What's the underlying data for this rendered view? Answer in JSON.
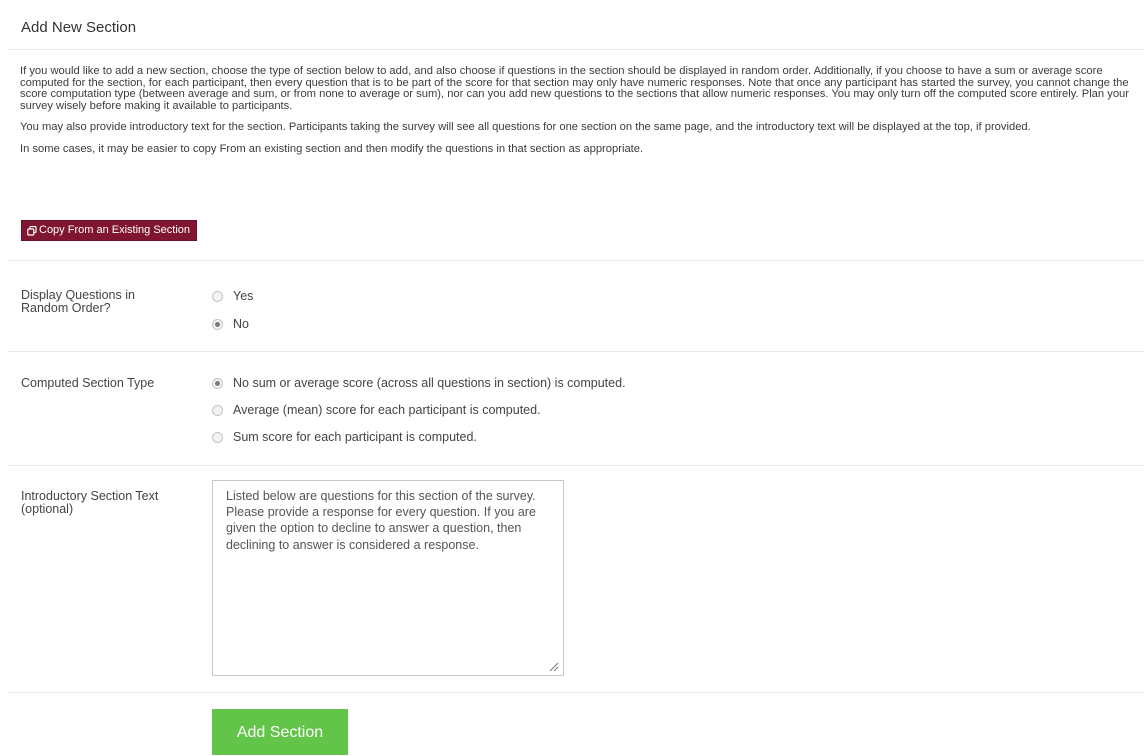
{
  "header": {
    "title": "Add New Section"
  },
  "intro": {
    "paragraph1": "If you would like to add a new section, choose the type of section below to add, and also choose if questions in the section should be displayed in random order. Additionally, if you choose to have a sum or average score computed for the section, for each participant, then every question that is to be part of the score for that section may only have numeric responses. Note that once any participant has started the survey, you cannot change the score computation type (between average and sum, or from none to average or sum), nor can you add new questions to the sections that allow numeric responses. You may only turn off the computed score entirely. Plan your survey wisely before making it available to participants.",
    "paragraph2": "You may also provide introductory text for the section. Participants taking the survey will see all questions for one section on the same page, and the introductory text will be displayed at the top, if provided.",
    "paragraph3": "In some cases, it may be easier to copy From an existing section and then modify the questions in that section as appropriate."
  },
  "copy_button": {
    "label": "Copy From an Existing Section",
    "icon": "copy-icon",
    "color": "#7f1530"
  },
  "random_order": {
    "label": "Display Questions in Random Order?",
    "options": [
      {
        "label": "Yes",
        "checked": false
      },
      {
        "label": "No",
        "checked": true
      }
    ]
  },
  "section_type": {
    "label": "Computed Section Type",
    "options": [
      {
        "label": "No sum or average score (across all questions in section) is computed.",
        "checked": true
      },
      {
        "label": "Average (mean) score for each participant is computed.",
        "checked": false
      },
      {
        "label": "Sum score for each participant is computed.",
        "checked": false
      }
    ]
  },
  "intro_text": {
    "label": "Introductory Section Text (optional)",
    "value": "Listed below are questions for this section of the survey. Please provide a response for every question. If you are given the option to decline to answer a question, then declining to answer is considered a response."
  },
  "add_button": {
    "label": "Add Section",
    "color": "#62c448"
  }
}
